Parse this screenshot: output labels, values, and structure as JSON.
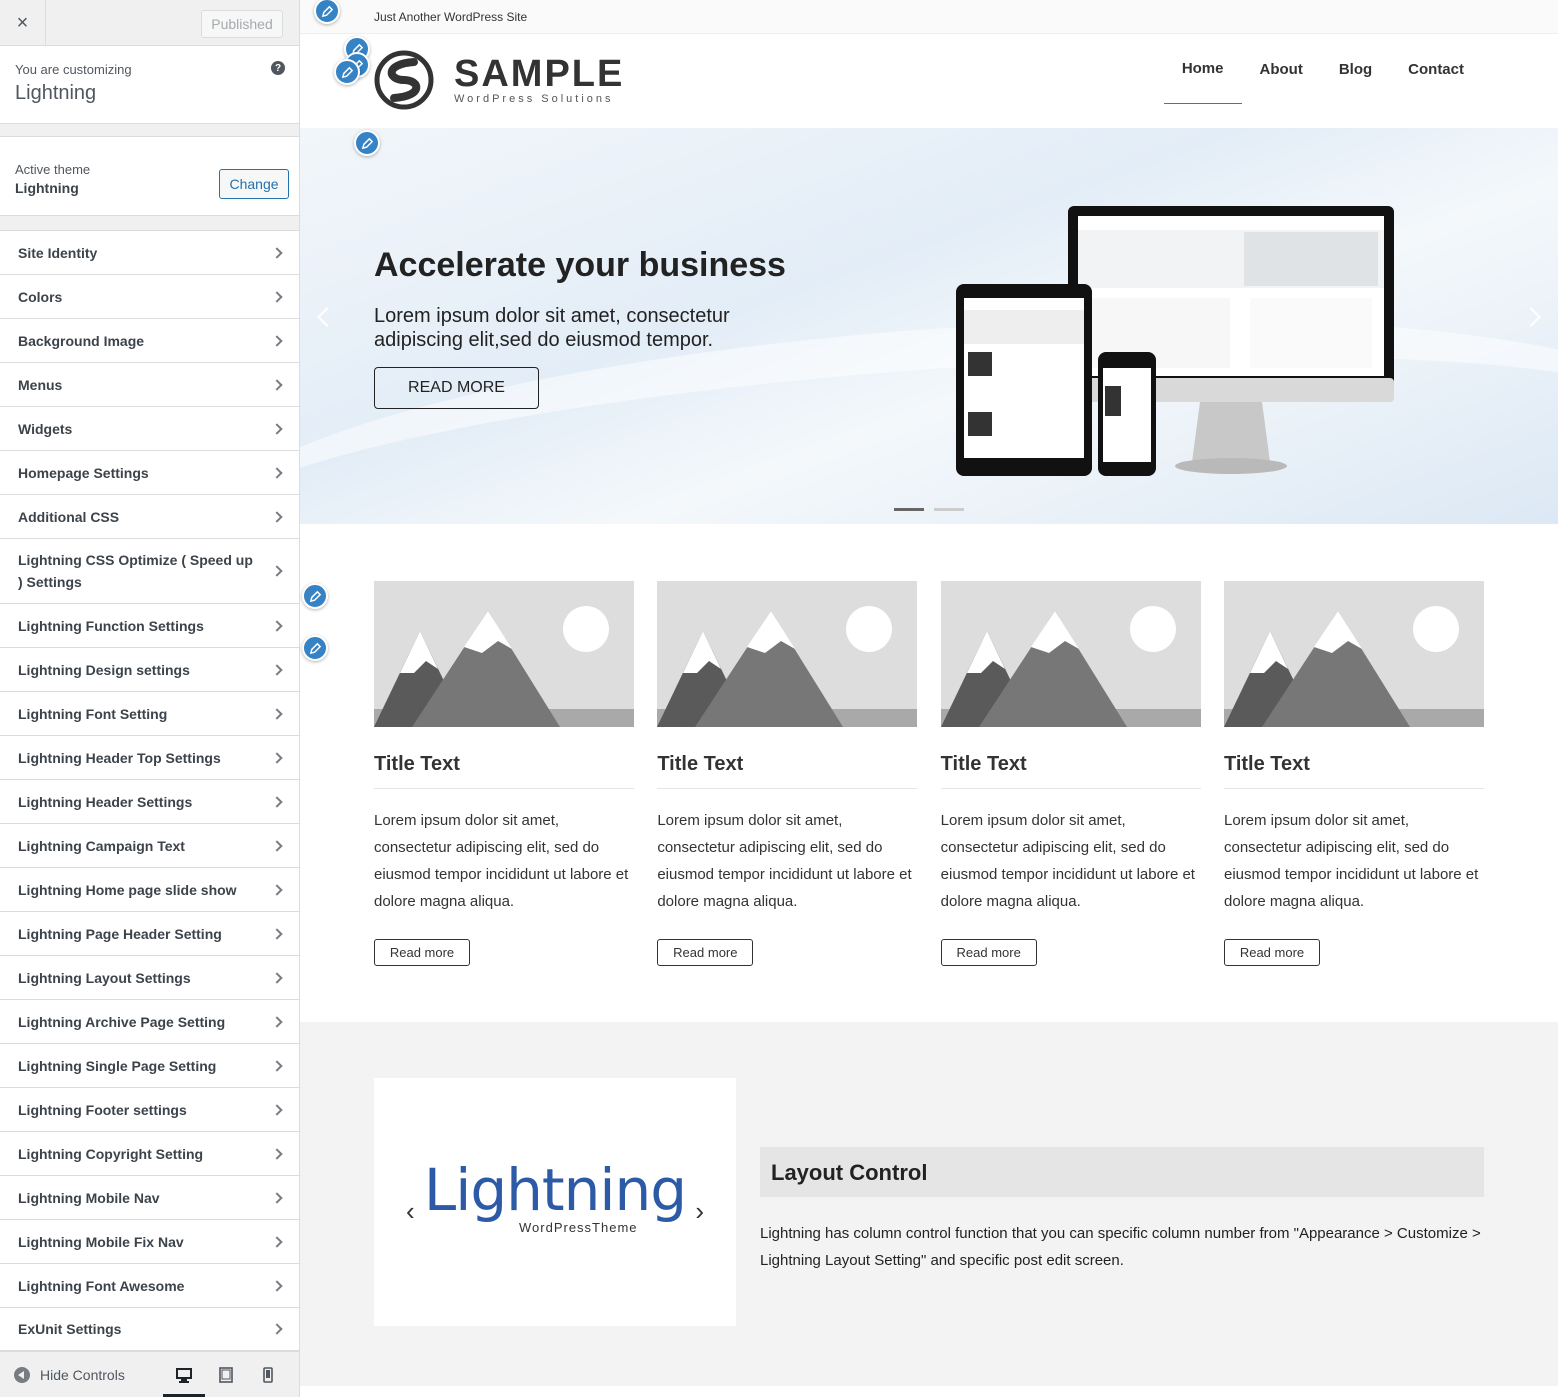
{
  "sidebar": {
    "close_label": "×",
    "publish_label": "Published",
    "customizing_label": "You are customizing",
    "site_name": "Lightning",
    "help_label": "?",
    "active_theme_label": "Active theme",
    "active_theme_name": "Lightning",
    "change_label": "Change",
    "sections": [
      "Site Identity",
      "Colors",
      "Background Image",
      "Menus",
      "Widgets",
      "Homepage Settings",
      "Additional CSS",
      "Lightning CSS Optimize ( Speed up ) Settings",
      "Lightning Function Settings",
      "Lightning Design settings",
      "Lightning Font Setting",
      "Lightning Header Top Settings",
      "Lightning Header Settings",
      "Lightning Campaign Text",
      "Lightning Home page slide show",
      "Lightning Page Header Setting",
      "Lightning Layout Settings",
      "Lightning Archive Page Setting",
      "Lightning Single Page Setting",
      "Lightning Footer settings",
      "Lightning Copyright Setting",
      "Lightning Mobile Nav",
      "Lightning Mobile Fix Nav",
      "Lightning Font Awesome",
      "ExUnit Settings"
    ],
    "hide_controls_label": "Hide Controls",
    "devices": [
      "desktop-icon",
      "tablet-icon",
      "mobile-icon"
    ],
    "active_device": "desktop"
  },
  "preview": {
    "tagline": "Just Another WordPress Site",
    "logo_title": "SAMPLE",
    "logo_subtitle": "WordPress Solutions",
    "nav": [
      "Home",
      "About",
      "Blog",
      "Contact"
    ],
    "active_nav": "Home",
    "hero": {
      "title": "Accelerate your business",
      "text": "Lorem ipsum dolor sit amet, consectetur adipiscing elit,sed do eiusmod tempor.",
      "button": "READ MORE",
      "slide_count": 2,
      "active_slide": 1
    },
    "cards": [
      {
        "title": "Title Text",
        "text": "Lorem ipsum dolor sit amet, consectetur adipiscing elit, sed do eiusmod tempor incididunt ut labore et dolore magna aliqua.",
        "button": "Read more"
      },
      {
        "title": "Title Text",
        "text": "Lorem ipsum dolor sit amet, consectetur adipiscing elit, sed do eiusmod tempor incididunt ut labore et dolore magna aliqua.",
        "button": "Read more"
      },
      {
        "title": "Title Text",
        "text": "Lorem ipsum dolor sit amet, consectetur adipiscing elit, sed do eiusmod tempor incididunt ut labore et dolore magna aliqua.",
        "button": "Read more"
      },
      {
        "title": "Title Text",
        "text": "Lorem ipsum dolor sit amet, consectetur adipiscing elit, sed do eiusmod tempor incididunt ut labore et dolore magna aliqua.",
        "button": "Read more"
      }
    ],
    "feature": {
      "logo_word": "Lightning",
      "logo_sub": "WordPressTheme",
      "title": "Layout Control",
      "text": "Lightning has column control function that you can specific column number from \"Appearance > Customize > Lightning Layout Setting\" and specific post edit screen."
    },
    "colors": {
      "edit_shortcut": "#3582c4",
      "accent": "#2271b1",
      "nav_underline": "#337ab7"
    }
  }
}
